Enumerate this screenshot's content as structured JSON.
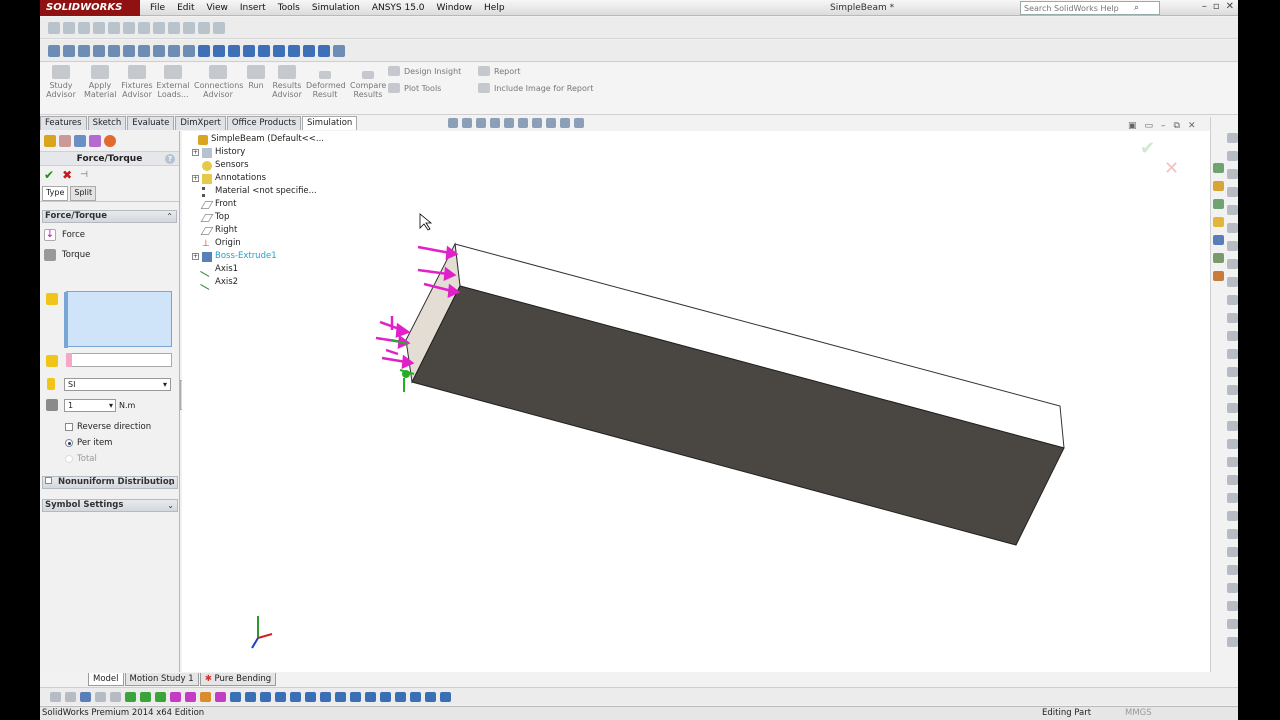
{
  "app": {
    "brand": "SOLIDWORKS",
    "document_title": "SimpleBeam *",
    "menus": [
      "File",
      "Edit",
      "View",
      "Insert",
      "Tools",
      "Simulation",
      "ANSYS 15.0",
      "Window",
      "Help"
    ],
    "help_search_placeholder": "Search SolidWorks Help"
  },
  "command_manager": {
    "buttons": [
      {
        "label": "Study\nAdvisor"
      },
      {
        "label": "Apply\nMaterial"
      },
      {
        "label": "Fixtures\nAdvisor"
      },
      {
        "label": "External\nLoads..."
      },
      {
        "label": "Connections\nAdvisor"
      },
      {
        "label": "Run"
      },
      {
        "label": "Results\nAdvisor"
      },
      {
        "label": "Deformed\nResult"
      },
      {
        "label": "Compare\nResults"
      }
    ],
    "side_items": {
      "design_insight": "Design Insight",
      "plot_tools": "Plot Tools",
      "report": "Report",
      "include_image": "Include Image for Report"
    },
    "tabs": [
      "Features",
      "Sketch",
      "Evaluate",
      "DimXpert",
      "Office Products",
      "Simulation"
    ],
    "active_tab": "Simulation"
  },
  "property_manager": {
    "title": "Force/Torque",
    "help": "?",
    "subtabs": [
      "Type",
      "Split"
    ],
    "group_force_torque": "Force/Torque",
    "force_label": "Force",
    "torque_label": "Torque",
    "unit_system": "SI",
    "value": "1",
    "value_unit": "N.m",
    "reverse_direction": "Reverse direction",
    "per_item": "Per item",
    "total": "Total",
    "nonuniform": "Nonuniform Distribution",
    "symbol_settings": "Symbol Settings"
  },
  "feature_tree": {
    "root": "SimpleBeam  (Default<<...",
    "items": [
      "History",
      "Sensors",
      "Annotations",
      "Material <not specifie...",
      "Front",
      "Top",
      "Right",
      "Origin",
      "Boss-Extrude1",
      "Axis1",
      "Axis2"
    ]
  },
  "model_tabs": [
    "Model",
    "Motion Study 1",
    "Pure Bending"
  ],
  "status": {
    "edition": "SolidWorks Premium 2014 x64 Edition",
    "mode": "Editing Part",
    "units": "MMGS"
  },
  "colors": {
    "load_arrows": "#e020c8",
    "fixture_arrows": "#22b022",
    "beam_face": "#4a4743",
    "brand": "#8f1111"
  }
}
